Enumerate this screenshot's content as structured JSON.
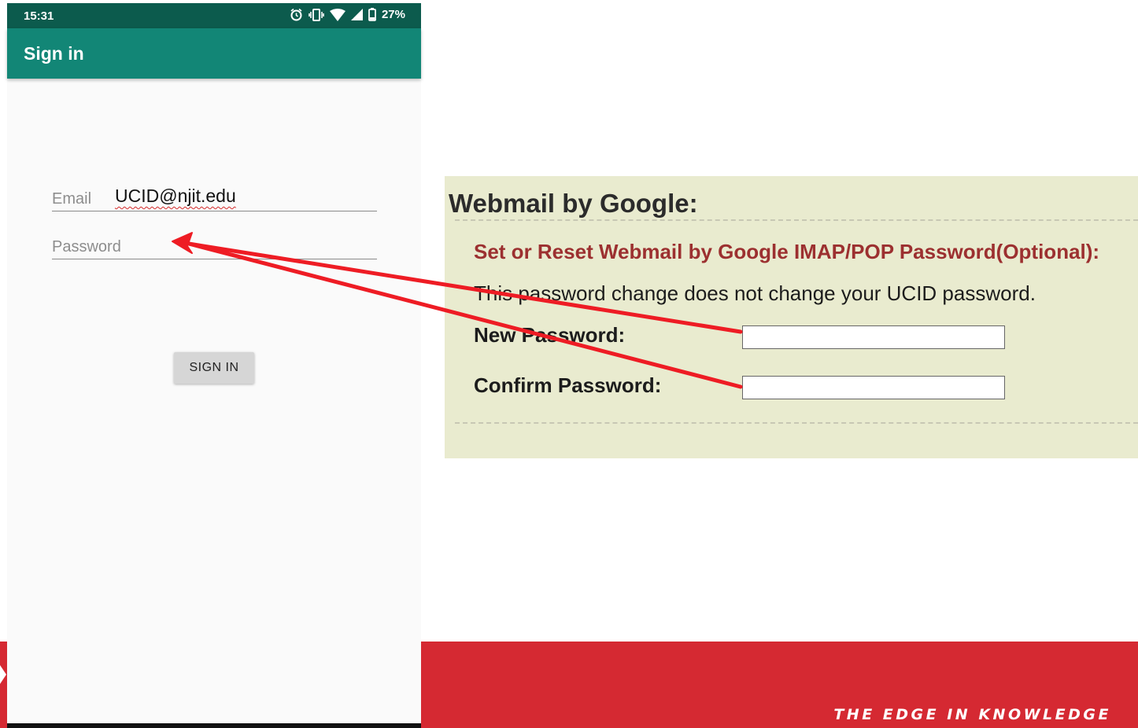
{
  "phone": {
    "status_bar": {
      "time": "15:31",
      "battery": "27%",
      "icons": [
        "alarm-icon",
        "vibrate-icon",
        "wifi-icon",
        "signal-icon",
        "battery-icon"
      ]
    },
    "app_bar": {
      "title": "Sign in"
    },
    "email": {
      "label": "Email",
      "value": "UCID@njit.edu"
    },
    "password": {
      "label": "Password",
      "value": ""
    },
    "sign_in_button": "SIGN IN"
  },
  "webmail": {
    "heading": "Webmail by Google:",
    "subheading": "Set or Reset Webmail by Google IMAP/POP Password(Optional):",
    "note": "This password change does not change your UCID password.",
    "new_password_label": "New Password:",
    "confirm_password_label": "Confirm Password:",
    "new_password_value": "",
    "confirm_password_value": ""
  },
  "footer": {
    "tagline": "THE EDGE IN KNOWLEDGE"
  },
  "colors": {
    "status_bar": "#0c5b4d",
    "app_bar": "#128676",
    "panel_background": "#e9ebcf",
    "subheading": "#9c3030",
    "annotation_arrow": "#ee1c24",
    "footer_band": "#d52932"
  }
}
